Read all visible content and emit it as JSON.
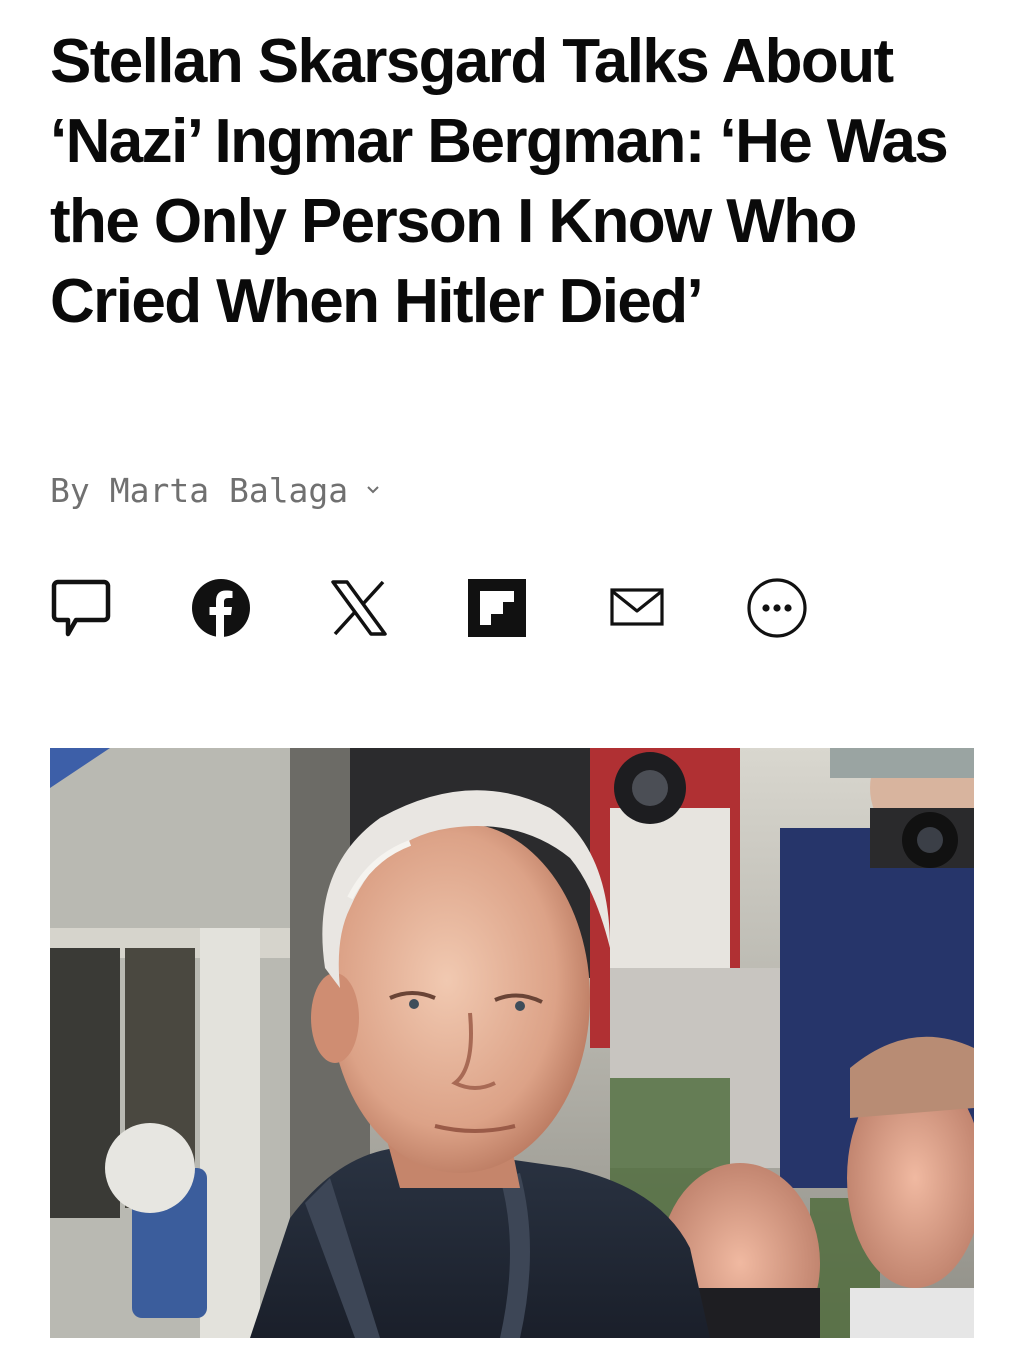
{
  "article": {
    "headline": "Stellan Skarsgard Talks About ‘Nazi’ Ingmar Bergman: ‘He Was the Only Person I Know Who Cried When Hitler Died’",
    "byline_prefix": "By",
    "author": "Marta Balaga"
  },
  "share_bar": {
    "icons": [
      "comment-icon",
      "facebook-icon",
      "x-icon",
      "flipboard-icon",
      "email-icon",
      "more-icon"
    ]
  },
  "colors": {
    "text": "#0a0a0a",
    "byline": "#707070"
  }
}
